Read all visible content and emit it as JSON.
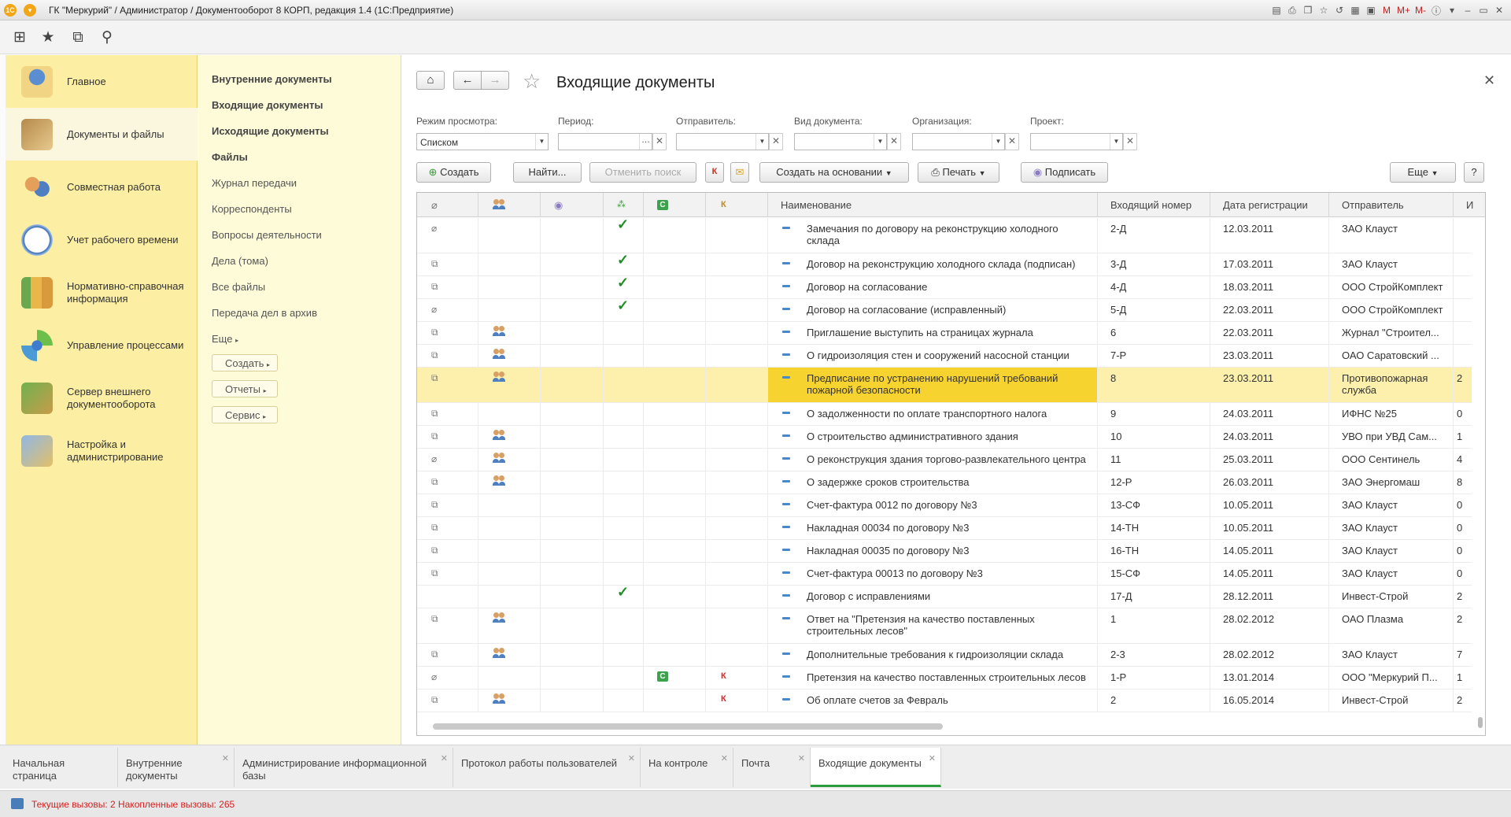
{
  "window": {
    "title": "ГК \"Меркурий\" / Администратор / Документооборот 8 КОРП, редакция 1.4  (1С:Предприятие)",
    "tools": [
      "M",
      "M+",
      "M-",
      "i"
    ]
  },
  "sidebar": {
    "items": [
      {
        "label": "Главное",
        "icon": "lamp-icon"
      },
      {
        "label": "Документы и файлы",
        "icon": "document-binder-icon"
      },
      {
        "label": "Совместная работа",
        "icon": "users-icon"
      },
      {
        "label": "Учет рабочего времени",
        "icon": "clock-icon"
      },
      {
        "label": "Нормативно-справочная информация",
        "icon": "folders-icon"
      },
      {
        "label": "Управление процессами",
        "icon": "atom-icon"
      },
      {
        "label": "Сервер внешнего документооборота",
        "icon": "server-icon"
      },
      {
        "label": "Настройка и администрирование",
        "icon": "computer-settings-icon"
      }
    ]
  },
  "subnav": {
    "bold": [
      "Внутренние документы",
      "Входящие документы",
      "Исходящие документы",
      "Файлы"
    ],
    "links": [
      "Журнал передачи",
      "Корреспонденты",
      "Вопросы деятельности",
      "Дела (тома)",
      "Все файлы",
      "Передача дел в архив"
    ],
    "more": "Еще",
    "buttons": [
      "Создать",
      "Отчеты",
      "Сервис"
    ]
  },
  "main": {
    "title": "Входящие документы",
    "filters": {
      "mode_label": "Режим просмотра:",
      "mode_value": "Списком",
      "period_label": "Период:",
      "sender_label": "Отправитель:",
      "doctype_label": "Вид документа:",
      "org_label": "Организация:",
      "project_label": "Проект:"
    },
    "toolbar": {
      "create": "Создать",
      "find": "Найти...",
      "cancel_search": "Отменить поиск",
      "k_button": "К",
      "create_based": "Создать на основании",
      "print": "Печать",
      "sign": "Подписать",
      "more": "Еще",
      "help": "?"
    },
    "columns": {
      "c": "С",
      "k": "К",
      "name": "Наименование",
      "number": "Входящий номер",
      "date": "Дата регистрации",
      "sender": "Отправитель",
      "extra": "И"
    },
    "rows": [
      {
        "clip": "single",
        "group": false,
        "check": true,
        "c": false,
        "k": false,
        "name": "Замечания по договору на реконструкцию холодного склада",
        "number": "2-Д",
        "date": "12.03.2011",
        "sender": "ЗАО Клауст",
        "extra": ""
      },
      {
        "clip": "multi",
        "group": false,
        "check": true,
        "c": false,
        "k": false,
        "name": "Договор на реконструкцию холодного склада (подписан)",
        "number": "3-Д",
        "date": "17.03.2011",
        "sender": "ЗАО Клауст",
        "extra": ""
      },
      {
        "clip": "multi",
        "group": false,
        "check": true,
        "c": false,
        "k": false,
        "name": "Договор на согласование",
        "number": "4-Д",
        "date": "18.03.2011",
        "sender": "ООО СтройКомплект",
        "extra": ""
      },
      {
        "clip": "single",
        "group": false,
        "check": true,
        "c": false,
        "k": false,
        "name": "Договор на согласование (исправленный)",
        "number": "5-Д",
        "date": "22.03.2011",
        "sender": "ООО СтройКомплект",
        "extra": ""
      },
      {
        "clip": "multi",
        "group": true,
        "check": false,
        "c": false,
        "k": false,
        "name": "Приглашение выступить на страницах журнала",
        "number": "6",
        "date": "22.03.2011",
        "sender": "Журнал \"Строител...",
        "extra": ""
      },
      {
        "clip": "multi",
        "group": true,
        "check": false,
        "c": false,
        "k": false,
        "name": "О гидроизоляция стен и сооружений насосной станции",
        "number": "7-Р",
        "date": "23.03.2011",
        "sender": "ОАО Саратовский ...",
        "extra": ""
      },
      {
        "clip": "multi",
        "group": true,
        "check": false,
        "c": false,
        "k": false,
        "name": "Предписание по устранению нарушений требований пожарной безопасности",
        "number": "8",
        "date": "23.03.2011",
        "sender": "Противопожарная служба",
        "extra": "2",
        "selected": true
      },
      {
        "clip": "multi",
        "group": false,
        "check": false,
        "c": false,
        "k": false,
        "name": "О задолженности по оплате транспортного налога",
        "number": "9",
        "date": "24.03.2011",
        "sender": "ИФНС №25",
        "extra": "0"
      },
      {
        "clip": "multi",
        "group": true,
        "check": false,
        "c": false,
        "k": false,
        "name": "О строительство административного здания",
        "number": "10",
        "date": "24.03.2011",
        "sender": "УВО при УВД Сам...",
        "extra": "1"
      },
      {
        "clip": "single",
        "group": true,
        "check": false,
        "c": false,
        "k": false,
        "name": "О реконструкция здания торгово-развлекательного центра",
        "number": "11",
        "date": "25.03.2011",
        "sender": "ООО Сентинель",
        "extra": "4"
      },
      {
        "clip": "multi",
        "group": true,
        "check": false,
        "c": false,
        "k": false,
        "name": "О задержке сроков строительства",
        "number": "12-Р",
        "date": "26.03.2011",
        "sender": "ЗАО Энергомаш",
        "extra": "8"
      },
      {
        "clip": "multi",
        "group": false,
        "check": false,
        "c": false,
        "k": false,
        "name": "Счет-фактура 0012 по договору №3",
        "number": "13-СФ",
        "date": "10.05.2011",
        "sender": "ЗАО Клауст",
        "extra": "0"
      },
      {
        "clip": "multi",
        "group": false,
        "check": false,
        "c": false,
        "k": false,
        "name": "Накладная 00034 по договору №3",
        "number": "14-ТН",
        "date": "10.05.2011",
        "sender": "ЗАО Клауст",
        "extra": "0"
      },
      {
        "clip": "multi",
        "group": false,
        "check": false,
        "c": false,
        "k": false,
        "name": "Накладная 00035 по договору №3",
        "number": "16-ТН",
        "date": "14.05.2011",
        "sender": "ЗАО Клауст",
        "extra": "0"
      },
      {
        "clip": "multi",
        "group": false,
        "check": false,
        "c": false,
        "k": false,
        "name": "Счет-фактура 00013 по договору №3",
        "number": "15-СФ",
        "date": "14.05.2011",
        "sender": "ЗАО Клауст",
        "extra": "0"
      },
      {
        "clip": "none",
        "group": false,
        "check": true,
        "c": false,
        "k": false,
        "name": "Договор с исправлениями",
        "number": "17-Д",
        "date": "28.12.2011",
        "sender": "Инвест-Строй",
        "extra": "2"
      },
      {
        "clip": "multi",
        "group": true,
        "check": false,
        "c": false,
        "k": false,
        "name": "Ответ на \"Претензия на качество поставленных строительных лесов\"",
        "number": "1",
        "date": "28.02.2012",
        "sender": "ОАО Плазма",
        "extra": "2"
      },
      {
        "clip": "multi",
        "group": true,
        "check": false,
        "c": false,
        "k": false,
        "name": "Дополнительные требования к гидроизоляции склада",
        "number": "2-3",
        "date": "28.02.2012",
        "sender": "ЗАО Клауст",
        "extra": "7"
      },
      {
        "clip": "single",
        "group": false,
        "check": false,
        "c": true,
        "k": true,
        "name": "Претензия на качество поставленных строительных лесов",
        "number": "1-Р",
        "date": "13.01.2014",
        "sender": "ООО \"Меркурий П...",
        "extra": "1"
      },
      {
        "clip": "multi",
        "group": true,
        "check": false,
        "c": false,
        "k": true,
        "name": "Об оплате счетов за Февраль",
        "number": "2",
        "date": "16.05.2014",
        "sender": "Инвест-Строй",
        "extra": "2"
      }
    ]
  },
  "tabs": [
    {
      "label": "Начальная страница",
      "closable": false
    },
    {
      "label": "Внутренние документы",
      "closable": true
    },
    {
      "label": "Администрирование информационной базы",
      "closable": true
    },
    {
      "label": "Протокол работы пользователей",
      "closable": true
    },
    {
      "label": "На контроле",
      "closable": true
    },
    {
      "label": "Почта",
      "closable": true
    },
    {
      "label": "Входящие документы",
      "closable": true,
      "active": true
    }
  ],
  "status": {
    "text": "Текущие вызовы: 2   Накопленные вызовы: 265"
  },
  "colors": {
    "sidebar": "#fcefa3",
    "subnav": "#fefbd9",
    "selected_row": "#fcf0ac",
    "selected_cell": "#f7d32f",
    "check": "#1f8d26",
    "active_tab": "#2a9c3e",
    "status_text": "#d32020"
  }
}
